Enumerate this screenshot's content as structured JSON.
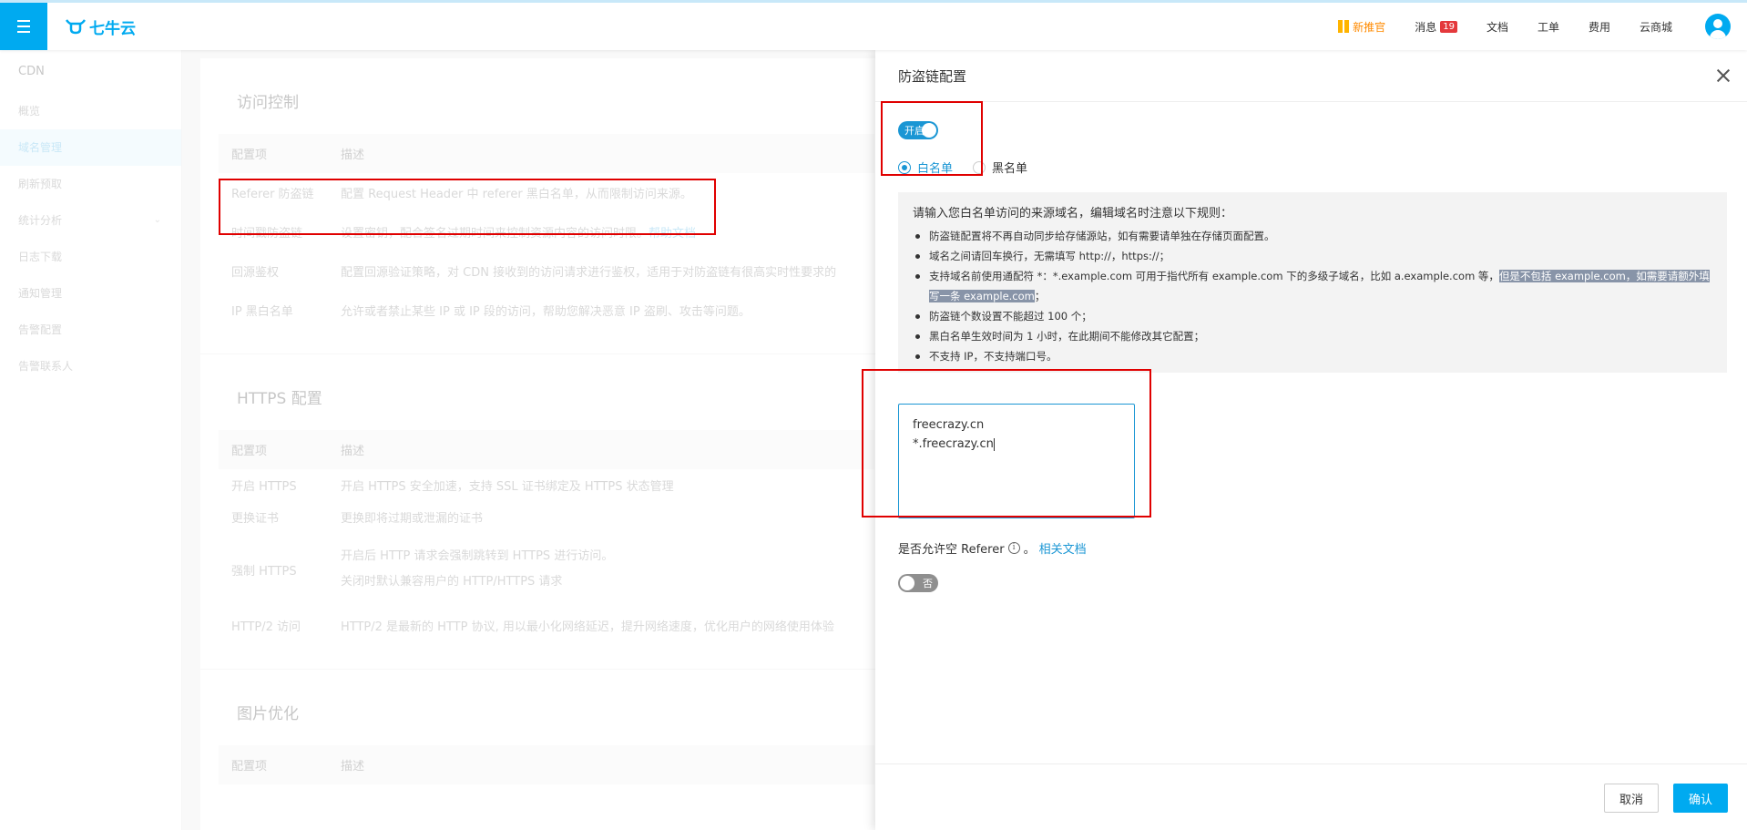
{
  "topbar": {
    "logo_text": "七牛云",
    "nav": {
      "new_official": "新推官",
      "messages": "消息",
      "messages_count": "19",
      "docs": "文档",
      "tickets": "工单",
      "billing": "费用",
      "marketplace": "云商城"
    }
  },
  "sidebar": {
    "title": "CDN",
    "items": [
      {
        "label": "概览"
      },
      {
        "label": "域名管理"
      },
      {
        "label": "刷新预取"
      },
      {
        "label": "统计分析"
      },
      {
        "label": "日志下载"
      },
      {
        "label": "通知管理"
      },
      {
        "label": "告警配置"
      },
      {
        "label": "告警联系人"
      }
    ]
  },
  "main": {
    "access_control": {
      "title": "访问控制",
      "headers": [
        "配置项",
        "描述"
      ],
      "rows": [
        {
          "name": "Referer 防盗链",
          "desc": "配置 Request Header 中 referer 黑白名单，从而限制访问来源。"
        },
        {
          "name": "时间戳防盗链",
          "desc": "设置密钥，配合签名过期时间来控制资源内容的访问时限。",
          "link": "帮助文档"
        },
        {
          "name": "回源鉴权",
          "desc": "配置回源验证策略，对 CDN 接收到的访问请求进行鉴权，适用于对防盗链有很高实时性要求的"
        },
        {
          "name": "IP 黑白名单",
          "desc": "允许或者禁止某些 IP 或 IP 段的访问，帮助您解决恶意 IP 盗刷、攻击等问题。"
        }
      ]
    },
    "https": {
      "title": "HTTPS 配置",
      "headers": [
        "配置项",
        "描述"
      ],
      "rows": [
        {
          "name": "开启 HTTPS",
          "desc": "开启 HTTPS 安全加速，支持 SSL 证书绑定及 HTTPS 状态管理"
        },
        {
          "name": "更换证书",
          "desc": "更换即将过期或泄漏的证书"
        },
        {
          "name": "强制 HTTPS",
          "desc": "开启后 HTTP 请求会强制跳转到 HTTPS 进行访问。",
          "desc2": "关闭时默认兼容用户的 HTTP/HTTPS 请求"
        },
        {
          "name": "HTTP/2 访问",
          "desc": "HTTP/2 是最新的 HTTP 协议, 用以最小化网络延迟，提升网络速度，优化用户的网络使用体验"
        }
      ]
    },
    "image": {
      "title": "图片优化",
      "headers": [
        "配置项",
        "描述"
      ]
    }
  },
  "drawer": {
    "title": "防盗链配置",
    "enable_toggle": "开启",
    "whitelist": "白名单",
    "blacklist": "黑名单",
    "rules_head": "请输入您白名单访问的来源域名，编辑域名时注意以下规则：",
    "rules": [
      "防盗链配置将不再自动同步给存储源站，如有需要请单独在存储页面配置。",
      "域名之间请回车换行，无需填写 http://，https://；",
      "支持域名前使用通配符 *：*.example.com 可用于指代所有 example.com 下的多级子域名，比如 a.example.com 等，",
      "防盗链个数设置不能超过 100 个；",
      "黑白名单生效时间为 1 小时，在此期间不能修改其它配置；",
      "不支持 IP，不支持端口号。"
    ],
    "rule3_highlight": "但是不包括 example.com，如需要请额外填写一条 example.com",
    "rule3_tail": "；",
    "textarea_line1": "freecrazy.cn",
    "textarea_line2": "*.freecrazy.cn",
    "allow_empty_label": "是否允许空 Referer",
    "info_glyph": "i",
    "period": "。",
    "related_docs": "相关文档",
    "empty_toggle": "否",
    "cancel": "取消",
    "confirm": "确认"
  },
  "colors": {
    "brand": "#00aaf0",
    "accent": "#1a96d4",
    "highlight_box": "#e00000"
  }
}
